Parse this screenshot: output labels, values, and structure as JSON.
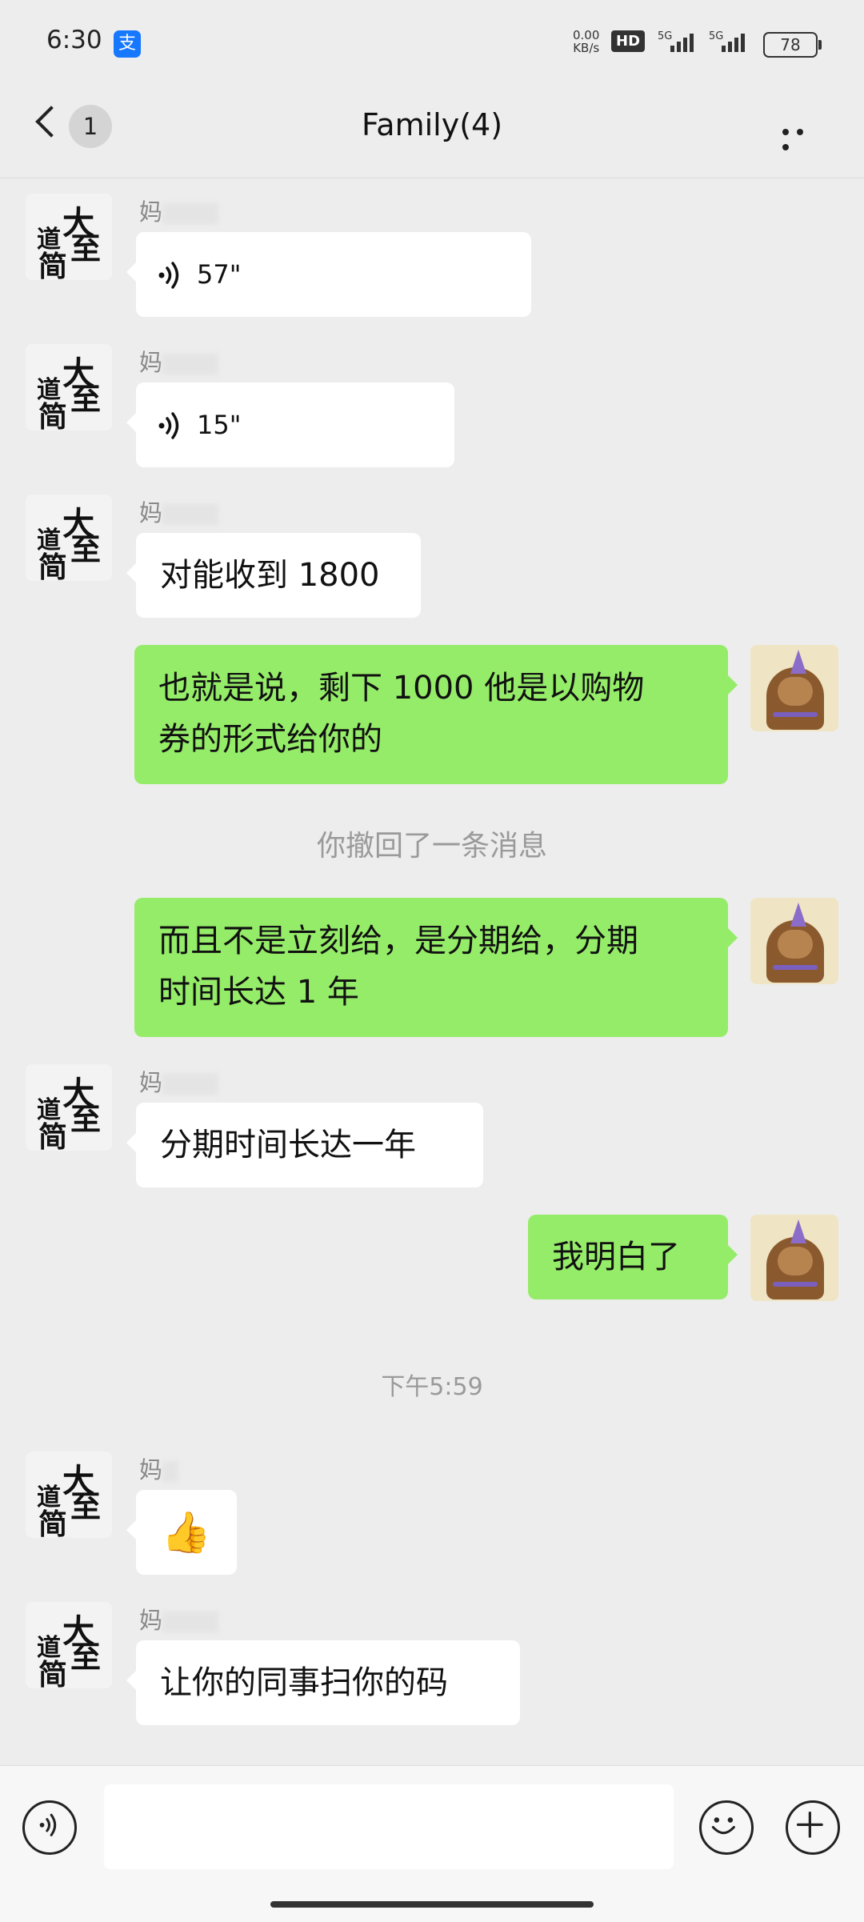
{
  "status_bar": {
    "time": "6:30",
    "app_badge": "支",
    "net_speed_value": "0.00",
    "net_speed_unit": "KB/s",
    "hd_label": "HD",
    "sig1_label": "5G",
    "sig2_label": "5G",
    "battery": "78"
  },
  "header": {
    "unread_count": "1",
    "title": "Family(4)"
  },
  "messages": [
    {
      "sender": "妈",
      "type": "voice",
      "duration": "57\""
    },
    {
      "sender": "妈",
      "type": "voice",
      "duration": "15\""
    },
    {
      "sender": "妈",
      "type": "text",
      "text": "对能收到 1800"
    },
    {
      "sender": "me",
      "type": "text",
      "line1": "也就是说，剩下 1000 他是以购物",
      "line2": "券的形式给你的"
    },
    {
      "type": "system",
      "text": "你撤回了一条消息"
    },
    {
      "sender": "me",
      "type": "text",
      "line1": "而且不是立刻给，是分期给，分期",
      "line2": "时间长达 1 年"
    },
    {
      "sender": "妈",
      "type": "text",
      "text": "分期时间长达一年"
    },
    {
      "sender": "me",
      "type": "text",
      "text": "我明白了"
    },
    {
      "type": "timestamp",
      "text": "下午5:59"
    },
    {
      "sender": "妈",
      "type": "emoji",
      "text": "👍"
    },
    {
      "sender": "妈",
      "type": "text",
      "text": "让你的同事扫你的码"
    }
  ],
  "other_avatar_chars": [
    "大",
    "至",
    "道",
    "简"
  ],
  "input": {
    "value": "",
    "placeholder": ""
  },
  "colors": {
    "background": "#ededed",
    "my_bubble": "#95ec69",
    "other_bubble": "#ffffff"
  },
  "icons": [
    "back-icon",
    "more-icon",
    "voice-icon",
    "voice-input-icon",
    "emoji-icon",
    "add-icon"
  ]
}
